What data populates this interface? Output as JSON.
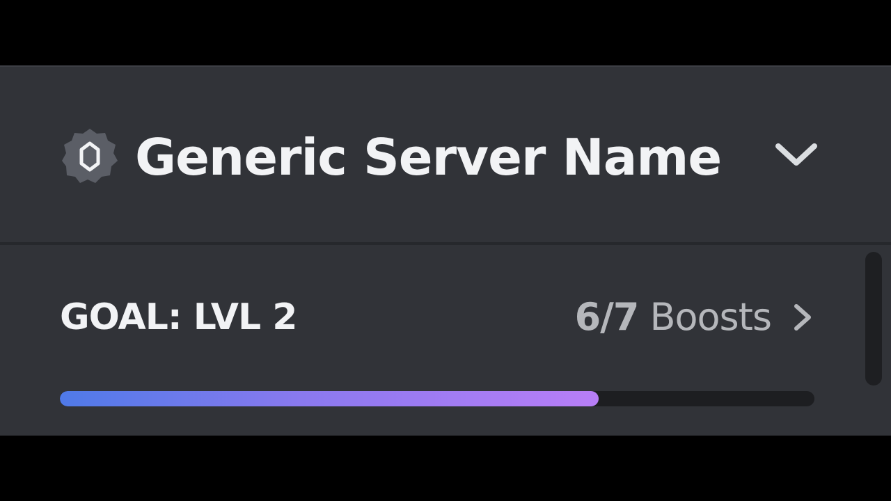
{
  "server": {
    "name": "Generic Server Name",
    "badge_icon": "boost-gem-badge-icon",
    "menu_icon": "chevron-down-icon"
  },
  "boost": {
    "goal_label": "GOAL: LVL 2",
    "count": "6/7",
    "unit_label": "Boosts",
    "link_icon": "chevron-right-icon",
    "current": 6,
    "target": 7,
    "progress_fraction": 0.714
  },
  "colors": {
    "background": "#313338",
    "frame_outer": "#000000",
    "title_text": "#f2f3f5",
    "muted_text": "#b5b7bb",
    "progress_start": "#4f7ae8",
    "progress_end": "#b87ef7",
    "track": "#1d1e21"
  }
}
